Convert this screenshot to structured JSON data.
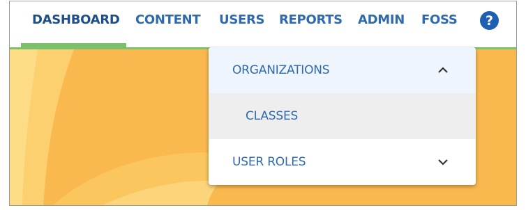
{
  "nav": {
    "items": [
      {
        "label": "DASHBOARD",
        "active": true
      },
      {
        "label": "CONTENT"
      },
      {
        "label": "USERS"
      },
      {
        "label": "REPORTS"
      },
      {
        "label": "ADMIN"
      },
      {
        "label": "FOSS"
      }
    ],
    "help_icon": "question-circle-icon",
    "help_glyph": "?"
  },
  "dropdown": {
    "items": [
      {
        "label": "ORGANIZATIONS",
        "state": "expanded",
        "icon": "chevron-up-icon"
      },
      {
        "label": "CLASSES",
        "sub_item": true
      },
      {
        "label": "USER ROLES",
        "state": "collapsed",
        "icon": "chevron-down-icon"
      }
    ]
  },
  "colors": {
    "nav_text": "#2f6ab0",
    "active_indicator": "#7bc06b",
    "banner": "#f9b94f",
    "help_icon": "#1f5fb3"
  }
}
